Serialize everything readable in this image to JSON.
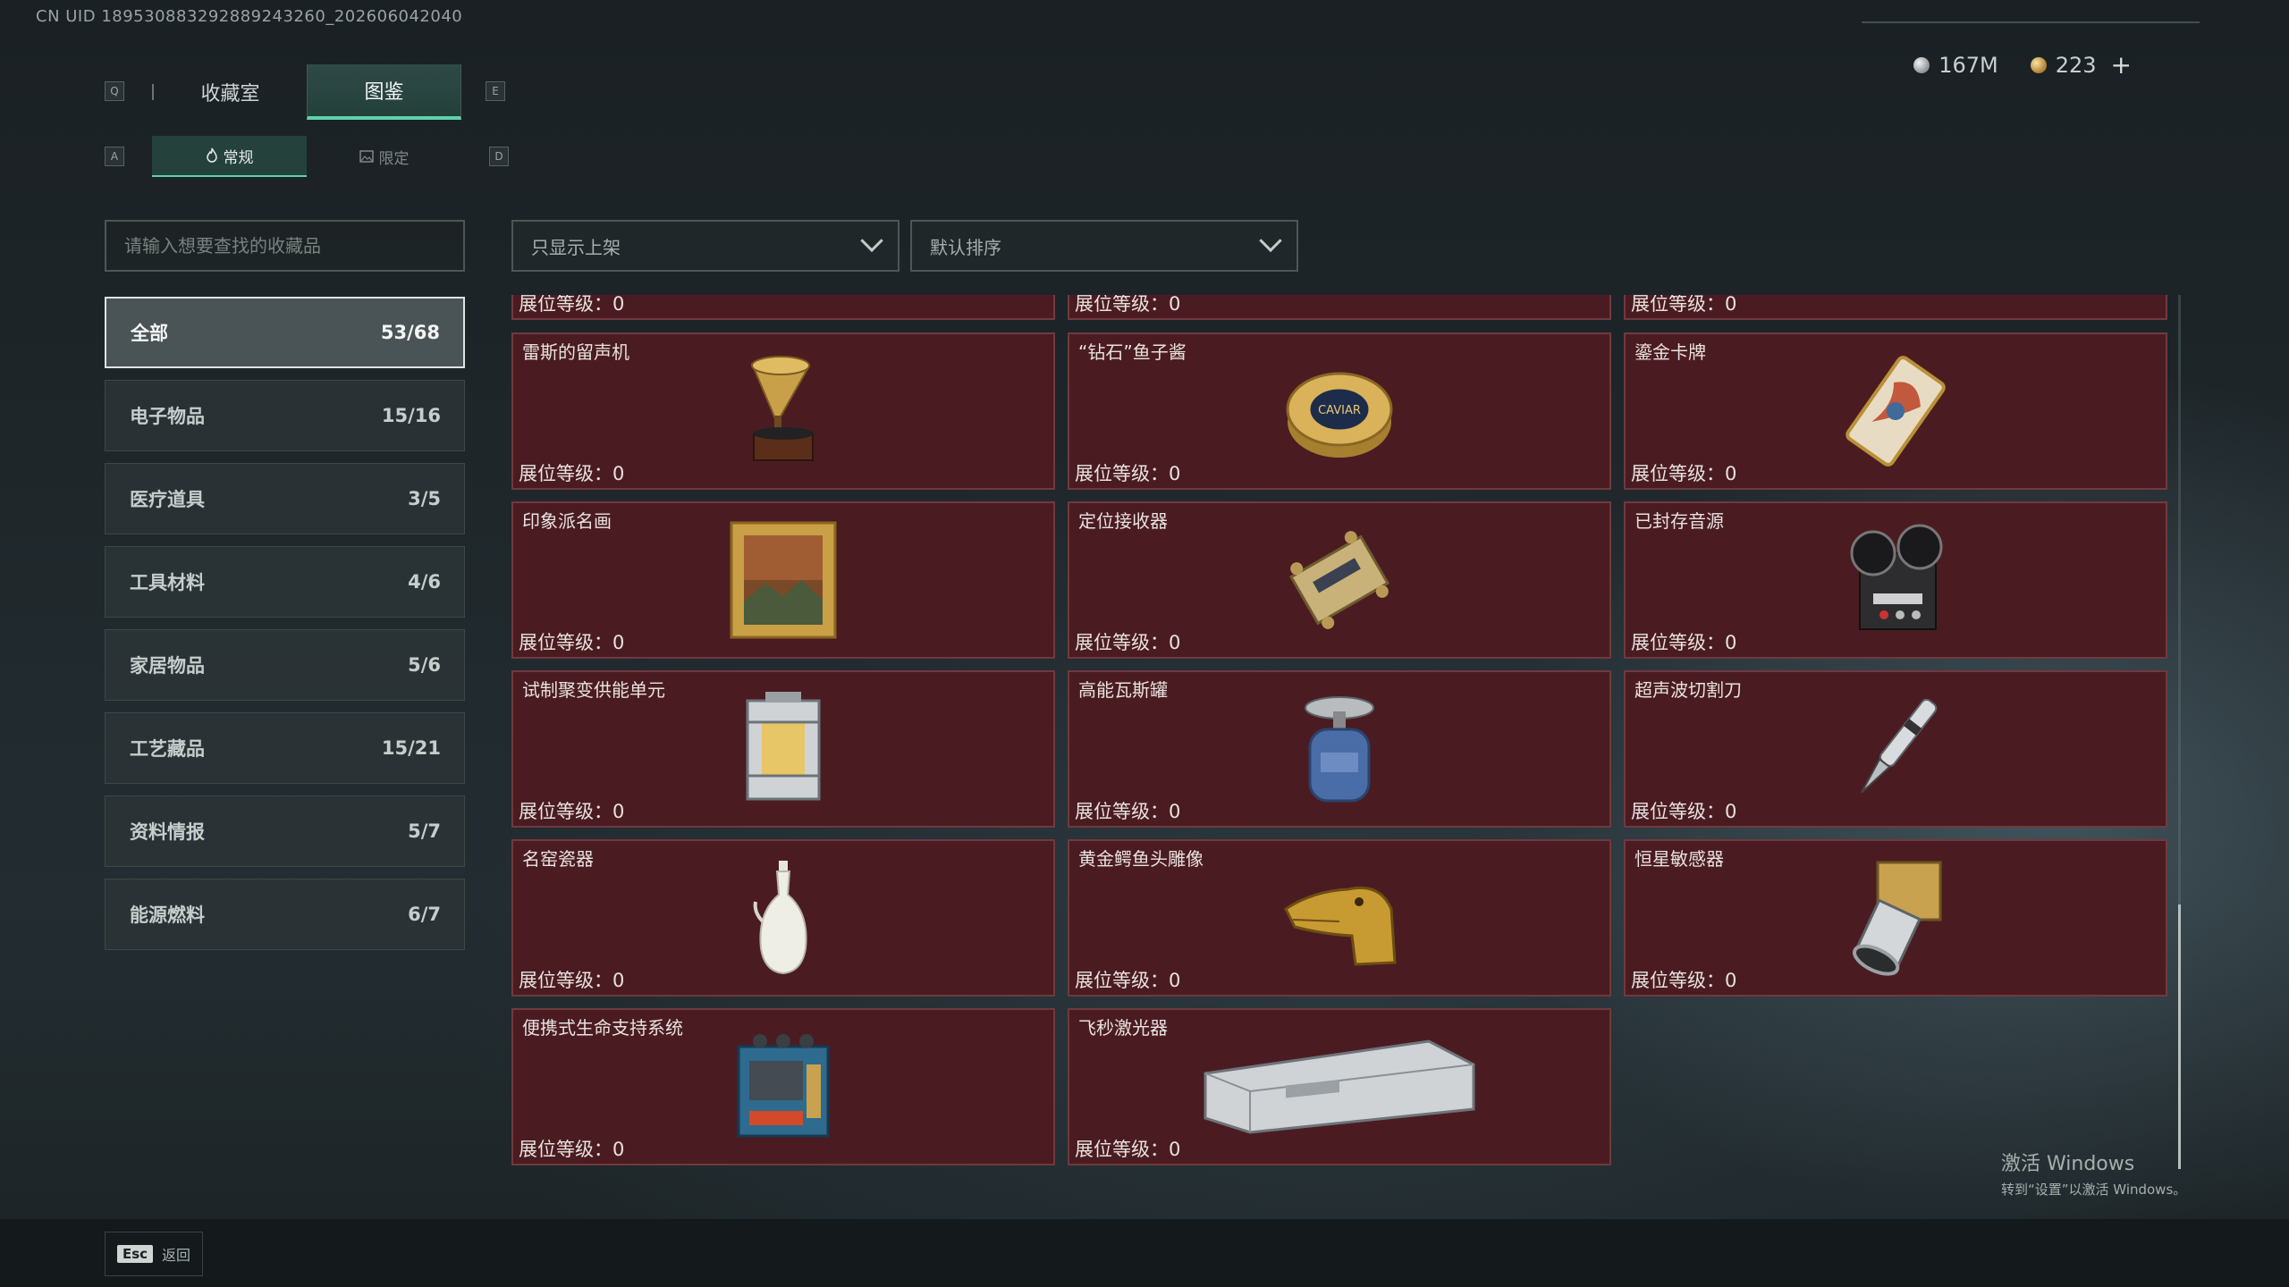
{
  "uid_text": "CN UID 1895308832928892432​60_202606042040",
  "currency": [
    {
      "value": "167M",
      "icon": "silver-coin-icon"
    },
    {
      "value": "223",
      "icon": "gold-coin-icon"
    }
  ],
  "currency_add_label": "+",
  "hotkeys": {
    "prev_tab": "Q",
    "next_tab": "E",
    "prev_sub": "A",
    "next_sub": "D"
  },
  "tabs": [
    {
      "label": "收藏室",
      "active": false
    },
    {
      "label": "图鉴",
      "active": true
    }
  ],
  "subtabs": [
    {
      "label": "常规",
      "icon": "flame-icon",
      "active": true
    },
    {
      "label": "限定",
      "icon": "image-icon",
      "active": false
    }
  ],
  "search": {
    "placeholder": "请输入想要查找的收藏品",
    "value": ""
  },
  "filters": {
    "shelf_filter": "只显示上架",
    "sort": "默认排序"
  },
  "categories": [
    {
      "label": "全部",
      "count": "53/68",
      "active": true
    },
    {
      "label": "电子物品",
      "count": "15/16",
      "active": false
    },
    {
      "label": "医疗道具",
      "count": "3/5",
      "active": false
    },
    {
      "label": "工具材料",
      "count": "4/6",
      "active": false
    },
    {
      "label": "家居物品",
      "count": "5/6",
      "active": false
    },
    {
      "label": "工艺藏品",
      "count": "15/21",
      "active": false
    },
    {
      "label": "资料情报",
      "count": "5/7",
      "active": false
    },
    {
      "label": "能源燃料",
      "count": "6/7",
      "active": false
    }
  ],
  "level_label": "展位等级：0",
  "partial_row": [
    {
      "name": "",
      "level": "展位等级：0"
    },
    {
      "name": "",
      "level": "展位等级：0"
    },
    {
      "name": "",
      "level": "展位等级：0"
    }
  ],
  "items": [
    {
      "name": "雷斯的留声机",
      "level": "展位等级：0",
      "icon": "gramophone-icon"
    },
    {
      "name": "“钻石”鱼子酱",
      "level": "展位等级：0",
      "icon": "caviar-tin-icon",
      "img_text": "CAVIAR"
    },
    {
      "name": "鎏金卡牌",
      "level": "展位等级：0",
      "icon": "gilded-card-icon"
    },
    {
      "name": "印象派名画",
      "level": "展位等级：0",
      "icon": "framed-painting-icon"
    },
    {
      "name": "定位接收器",
      "level": "展位等级：0",
      "icon": "gps-receiver-icon"
    },
    {
      "name": "已封存音源",
      "level": "展位等级：0",
      "icon": "reel-to-reel-recorder-icon"
    },
    {
      "name": "试制聚变供能单元",
      "level": "展位等级：0",
      "icon": "fusion-cell-icon"
    },
    {
      "name": "高能瓦斯罐",
      "level": "展位等级：0",
      "icon": "gas-canister-icon"
    },
    {
      "name": "超声波切割刀",
      "level": "展位等级：0",
      "icon": "ultrasonic-cutter-icon"
    },
    {
      "name": "名窑瓷器",
      "level": "展位等级：0",
      "icon": "porcelain-vase-icon"
    },
    {
      "name": "黄金鳄鱼头雕像",
      "level": "展位等级：0",
      "icon": "gold-crocodile-head-icon"
    },
    {
      "name": "恒星敏感器",
      "level": "展位等级：0",
      "icon": "star-sensor-icon"
    },
    {
      "name": "便携式生命支持系统",
      "level": "展位等级：0",
      "icon": "life-support-system-icon"
    },
    {
      "name": "飞秒激光器",
      "level": "展位等级：0",
      "icon": "femtosecond-laser-icon"
    }
  ],
  "footer": {
    "esc_key": "Esc",
    "esc_label": "返回"
  },
  "watermark": {
    "line1": "激活 Windows",
    "line2": "转到“设置”以激活 Windows。"
  },
  "colors": {
    "accent": "#5fd2a9",
    "card_bg": "#4a1c21",
    "card_border": "#6f3a3e"
  }
}
